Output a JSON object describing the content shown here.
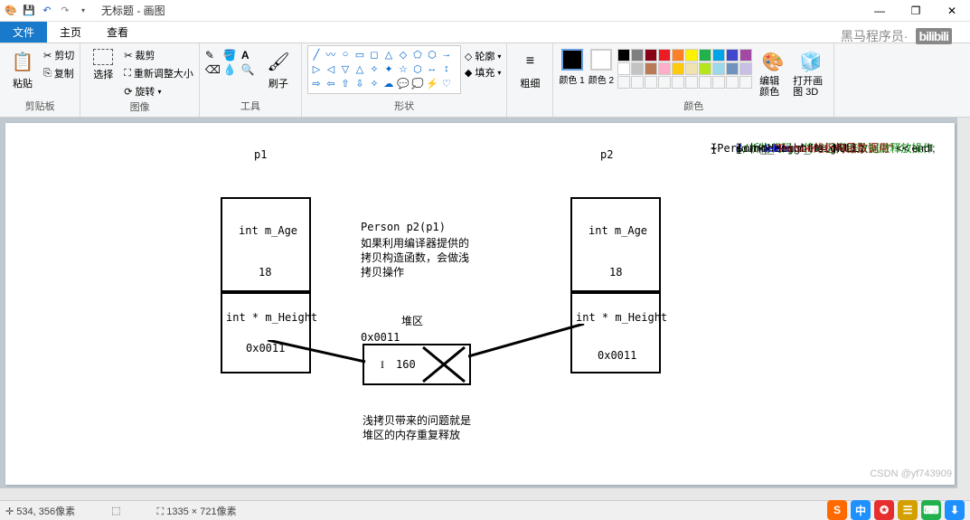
{
  "window": {
    "title": "无标题 - 画图",
    "min": "—",
    "max": "❐",
    "close": "✕"
  },
  "qat": {
    "save": "💾",
    "undo": "↶",
    "redo": "↷",
    "dd": "▾"
  },
  "tabs": {
    "file": "文件",
    "home": "主页",
    "view": "查看"
  },
  "watermark": {
    "text": "黑马程序员·",
    "bili": "bilibili"
  },
  "ribbon": {
    "clipboard": {
      "label": "剪贴板",
      "paste": "粘贴",
      "cut": "剪切",
      "copy": "复制"
    },
    "image": {
      "label": "图像",
      "select": "选择",
      "crop": "裁剪",
      "resize": "重新调整大小",
      "rotate": "旋转"
    },
    "tools": {
      "label": "工具",
      "brush": "刷子"
    },
    "shapes": {
      "label": "形状",
      "outline": "轮廓",
      "fill": "填充"
    },
    "thickness": {
      "label": "粗细"
    },
    "colors": {
      "label": "颜色",
      "c1": "颜色 1",
      "c2": "颜色 2",
      "edit": "编辑颜色",
      "open3d": "打开画图 3D"
    }
  },
  "canvas": {
    "p1": "p1",
    "p2": "p2",
    "b1a": "int m_Age",
    "b1b": "18",
    "b1c": "int * m_Height",
    "b1d": "0x0011",
    "b2a": "int  m_Age",
    "b2b": "18",
    "b2c": "int * m_Height",
    "b2d": "0x0011",
    "mid_title": "Person p2(p1)",
    "mid_l1": "如果利用编译器提供的",
    "mid_l2": "拷贝构造函数，会做浅",
    "mid_l3": "拷贝操作",
    "heap_label": "堆区",
    "heap_addr": "0x0011",
    "heap_val": "160",
    "note1": "浅拷贝带来的问题就是",
    "note2": "堆区的内存重复释放",
    "code": {
      "l1": "~Person()",
      "l2": "{",
      "l3": "//析构代码，将堆区开辟数据做释放操作",
      "l4": "if (m_Height != NULL)",
      "l5": "{",
      "l6": "delete m_Height;",
      "l7": "m_Height = NULL;",
      "l8": "}",
      "l9a": "cout << ",
      "l9b": "\"Person的析构函数调用\"",
      "l9c": " << endl;",
      "l10": "}"
    }
  },
  "status": {
    "pos": "534, 356像素",
    "size": "1335 × 721像素"
  },
  "csdn": "CSDN @yf743909"
}
